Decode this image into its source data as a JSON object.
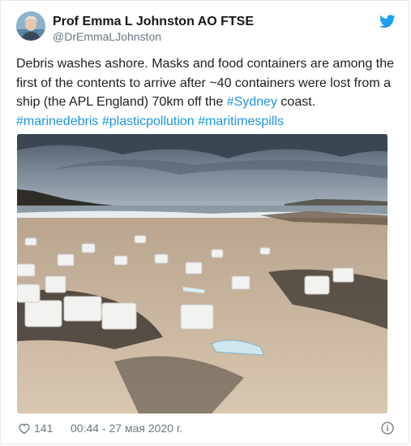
{
  "author": {
    "name": "Prof Emma L Johnston AO FTSE",
    "handle": "@DrEmmaLJohnston",
    "avatar_icon": "profile-photo"
  },
  "tweet": {
    "text_1": "Debris washes ashore. Masks and food containers are among the first of the contents to arrive after ~40 containers were lost from a ship (the APL England) 70km off the ",
    "hashtag_sydney": "#Sydney",
    "text_2": " coast.",
    "hashtag_1": "#marinedebris",
    "hashtag_2": "#plasticpollution",
    "hashtag_3": "#maritimespills"
  },
  "photo": {
    "icon": "beach-debris-photo"
  },
  "footer": {
    "like_count": "141",
    "timestamp": "00:44 - 27 мая 2020 г."
  },
  "colors": {
    "link": "#1b95e0",
    "twitter_blue": "#1da1f2",
    "muted": "#697882"
  }
}
